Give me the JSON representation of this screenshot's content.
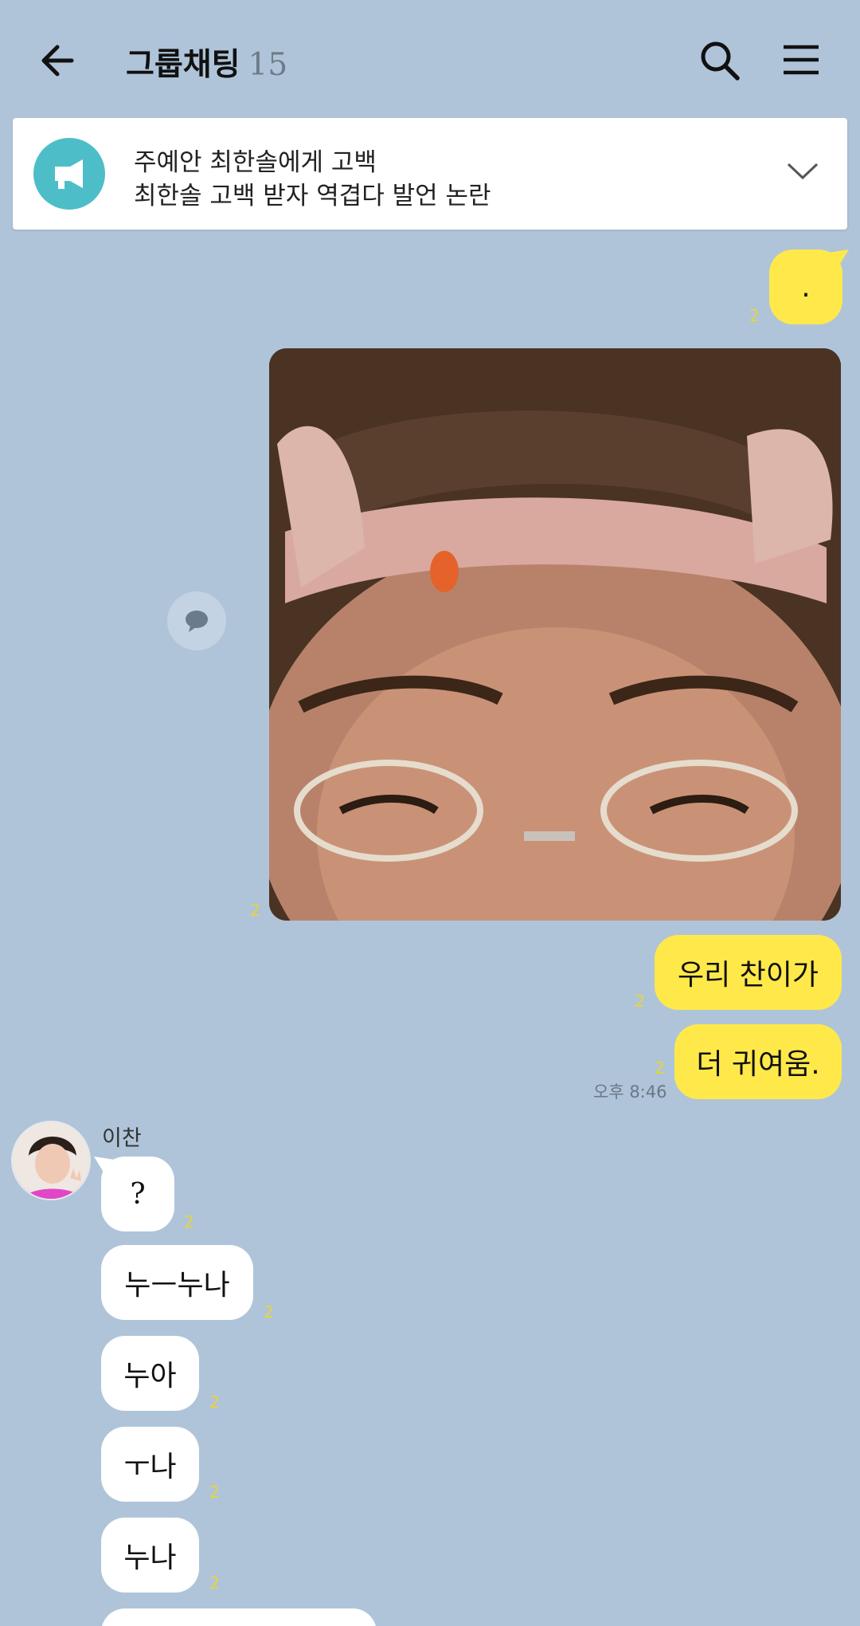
{
  "header": {
    "title": "그룹채팅",
    "member_count": "15"
  },
  "notice": {
    "line1": "주예안 최한솔에게 고백",
    "line2": "최한솔 고백 받자 역겹다 발언 논란"
  },
  "messages": {
    "m1": {
      "text": ".",
      "unread": "2"
    },
    "photo": {
      "unread": "2"
    },
    "m2": {
      "text": "우리 찬이가",
      "unread": "2"
    },
    "m3": {
      "text": "더 귀여움.",
      "unread": "2",
      "time": "오후 8:46"
    }
  },
  "incoming": {
    "sender": "이찬",
    "items": [
      {
        "text": "?",
        "unread": "2"
      },
      {
        "text": "누ㅡ누나",
        "unread": "2"
      },
      {
        "text": "누아",
        "unread": "2"
      },
      {
        "text": "ㅜ나",
        "unread": "2"
      },
      {
        "text": "누나",
        "unread": "2"
      }
    ]
  },
  "colors": {
    "background": "#afc4d9",
    "my_bubble": "#ffe94a",
    "their_bubble": "#ffffff",
    "notice_icon": "#4dbec8",
    "unread_count": "#e8d43a"
  },
  "icons": {
    "back": "arrow-left-icon",
    "search": "search-icon",
    "menu": "hamburger-menu-icon",
    "notice": "megaphone-icon",
    "expand": "chevron-down-icon",
    "share": "speech-bubble-icon"
  }
}
